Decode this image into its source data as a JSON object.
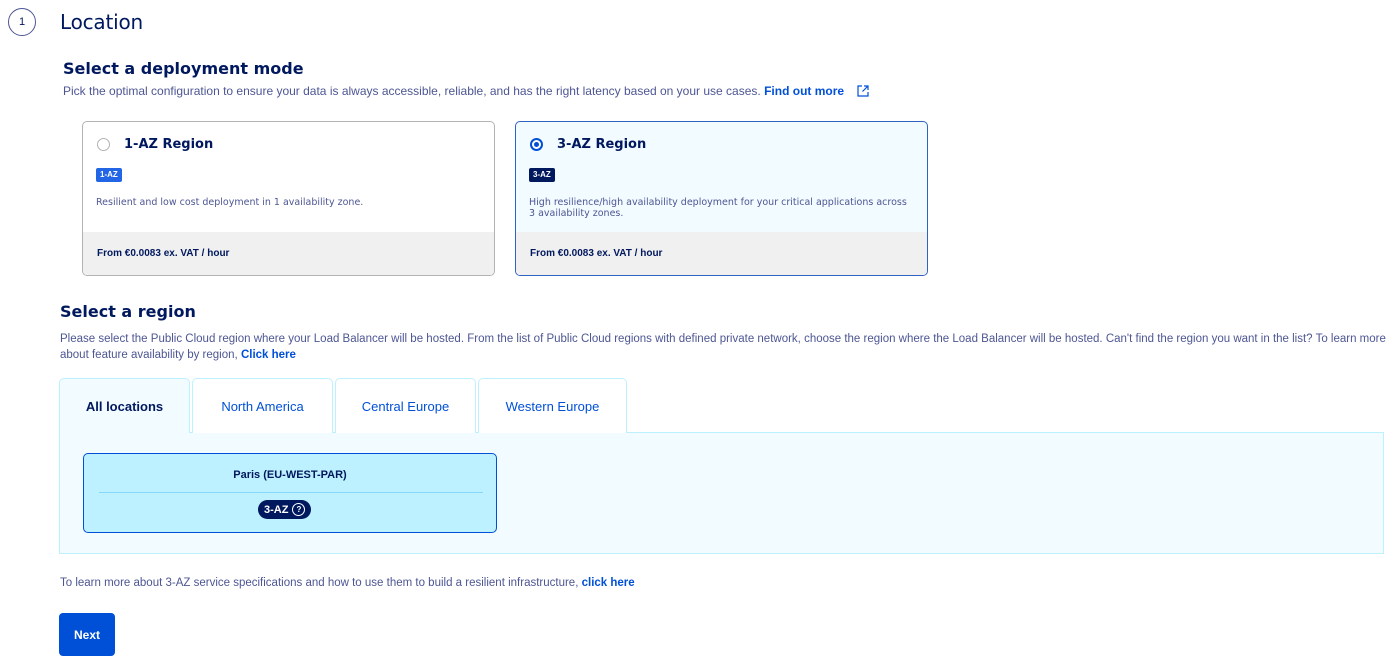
{
  "step": {
    "number": "1",
    "title": "Location"
  },
  "deployment": {
    "title": "Select a deployment mode",
    "description": "Pick the optimal configuration to ensure your data is always accessible, reliable, and has the right latency based on your use cases.",
    "link": "Find out more",
    "modes": [
      {
        "label": "1-AZ Region",
        "badge": "1-AZ",
        "description": "Resilient and low cost deployment in 1 availability zone.",
        "price": "From €0.0083 ex. VAT / hour",
        "selected": false
      },
      {
        "label": "3-AZ Region",
        "badge": "3-AZ",
        "description": "High resilience/high availability deployment for your critical applications across 3 availability zones.",
        "price": "From €0.0083 ex. VAT / hour",
        "selected": true
      }
    ]
  },
  "region": {
    "title": "Select a region",
    "description": "Please select the Public Cloud region where your Load Balancer will be hosted. From the list of Public Cloud regions with defined private network, choose the region where the Load Balancer will be hosted. Can't find the region you want in the list? To learn more about feature availability by region,",
    "link": "Click here",
    "tabs": [
      "All locations",
      "North America",
      "Central Europe",
      "Western Europe"
    ],
    "active_tab": "All locations",
    "cards": [
      {
        "name": "Paris (EU-WEST-PAR)",
        "badge": "3-AZ",
        "help_icon": "question-icon"
      }
    ]
  },
  "footer": {
    "note": "To learn more about 3-AZ service specifications and how to use them to build a resilient infrastructure,",
    "link": "click here"
  },
  "actions": {
    "next": "Next"
  },
  "colors": {
    "primary": "#0050d7",
    "dark": "#00185e",
    "text": "#4d5693",
    "light_bg": "#f2fbff",
    "selected_card": "#bef1ff"
  }
}
